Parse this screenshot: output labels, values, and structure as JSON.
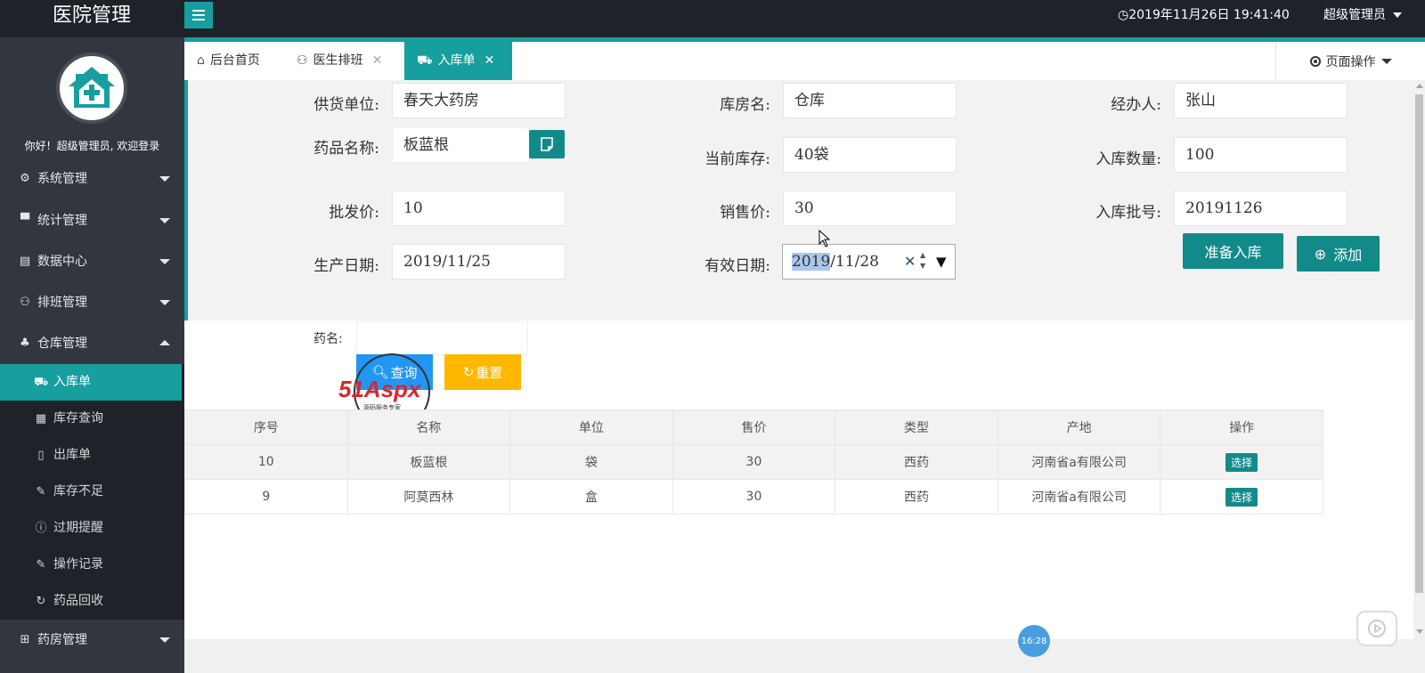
{
  "topbar": {
    "brand": "医院管理",
    "datetime": "2019年11月26日 19:41:40",
    "user": "超级管理员"
  },
  "sidebar": {
    "welcome": "你好！超级管理员, 欢迎登录",
    "menus": [
      {
        "label": "系统管理",
        "icon": "gear-icon"
      },
      {
        "label": "统计管理",
        "icon": "monitor-icon"
      },
      {
        "label": "数据中心",
        "icon": "document-icon"
      },
      {
        "label": "排班管理",
        "icon": "user-icon"
      },
      {
        "label": "仓库管理",
        "icon": "warehouse-icon"
      },
      {
        "label": "药房管理",
        "icon": "pharmacy-icon"
      }
    ],
    "warehouse_sub": [
      {
        "label": "入库单",
        "icon": "cart-icon"
      },
      {
        "label": "库存查询",
        "icon": "calendar-icon"
      },
      {
        "label": "出库单",
        "icon": "file-icon"
      },
      {
        "label": "库存不足",
        "icon": "edit-icon"
      },
      {
        "label": "过期提醒",
        "icon": "info-icon"
      },
      {
        "label": "操作记录",
        "icon": "edit-icon"
      },
      {
        "label": "药品回收",
        "icon": "refresh-icon"
      }
    ]
  },
  "tabs": [
    {
      "label": "后台首页",
      "icon": "home-icon"
    },
    {
      "label": "医生排班",
      "icon": "user-icon"
    },
    {
      "label": "入库单",
      "icon": "cart-icon"
    }
  ],
  "page_ops": "页面操作",
  "form": {
    "supplier": {
      "label": "供货单位:",
      "value": "春天大药房"
    },
    "warehouse": {
      "label": "库房名:",
      "value": "仓库"
    },
    "handler": {
      "label": "经办人:",
      "value": "张山"
    },
    "drug_name": {
      "label": "药品名称:",
      "value": "板蓝根"
    },
    "stock": {
      "label": "当前库存:",
      "value": "40袋"
    },
    "quantity": {
      "label": "入库数量:",
      "value": "100"
    },
    "wholesale": {
      "label": "批发价:",
      "value": "10"
    },
    "sale_price": {
      "label": "销售价:",
      "value": "30"
    },
    "batch_no": {
      "label": "入库批号:",
      "value": "20191126"
    },
    "prod_date": {
      "label": "生产日期:",
      "value": "2019/11/25"
    },
    "expiry": {
      "label": "有效日期:",
      "year": "2019",
      "rest": "/11/28"
    },
    "prepare_btn": "准备入库",
    "add_btn": "添加"
  },
  "search": {
    "label": "药名:",
    "query_btn": "查询",
    "reset_btn": "重置"
  },
  "watermark": {
    "brand": "51Aspx",
    "tagline": "源码服务专家"
  },
  "table": {
    "headers": [
      "序号",
      "名称",
      "单位",
      "售价",
      "类型",
      "产地",
      "操作"
    ],
    "rows": [
      [
        "10",
        "板蓝根",
        "袋",
        "30",
        "西药",
        "河南省a有限公司",
        "选择"
      ],
      [
        "9",
        "阿莫西林",
        "盒",
        "30",
        "西药",
        "河南省a有限公司",
        "选择"
      ]
    ]
  },
  "timer": "16:28",
  "colors": {
    "accent": "#179e9e",
    "dark": "#1f2329",
    "sidebar": "#32363e",
    "query": "#2196f3",
    "reset": "#ffb800"
  }
}
